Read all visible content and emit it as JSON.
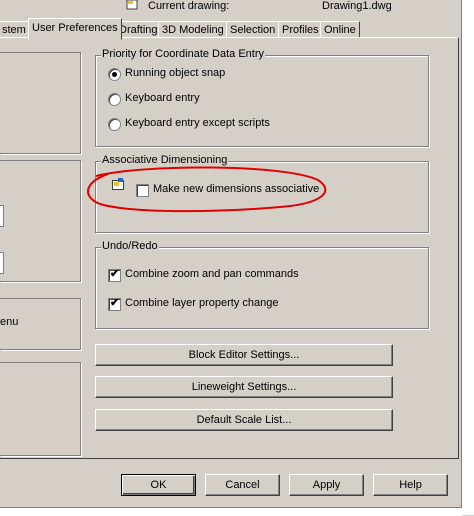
{
  "header": {
    "current_drawing_label": "Current drawing:",
    "current_drawing_value": "Drawing1.dwg"
  },
  "tabs": [
    {
      "label": "stem"
    },
    {
      "label": "User Preferences"
    },
    {
      "label": "Drafting"
    },
    {
      "label": "3D Modeling"
    },
    {
      "label": "Selection"
    },
    {
      "label": "Profiles"
    },
    {
      "label": "Online"
    }
  ],
  "left_partial": {
    "menu_fragment": "enu"
  },
  "priority_group": {
    "title": "Priority for Coordinate Data Entry",
    "options": [
      {
        "label": "Running object snap",
        "selected": true
      },
      {
        "label": "Keyboard entry",
        "selected": false
      },
      {
        "label": "Keyboard entry except scripts",
        "selected": false
      }
    ]
  },
  "assoc_group": {
    "title": "Associative Dimensioning",
    "checkbox_label": "Make new dimensions associative",
    "checked": false,
    "icon": "drawing-setting-icon",
    "annotation_color": "#e00000"
  },
  "undo_group": {
    "title": "Undo/Redo",
    "checkboxes": [
      {
        "label": "Combine zoom and pan commands",
        "checked": true
      },
      {
        "label": "Combine layer property change",
        "checked": true
      }
    ]
  },
  "buttons": {
    "block_editor": "Block Editor Settings...",
    "lineweight": "Lineweight Settings...",
    "default_scale": "Default Scale List..."
  },
  "footer": {
    "ok": "OK",
    "cancel": "Cancel",
    "apply": "Apply",
    "help": "Help"
  }
}
